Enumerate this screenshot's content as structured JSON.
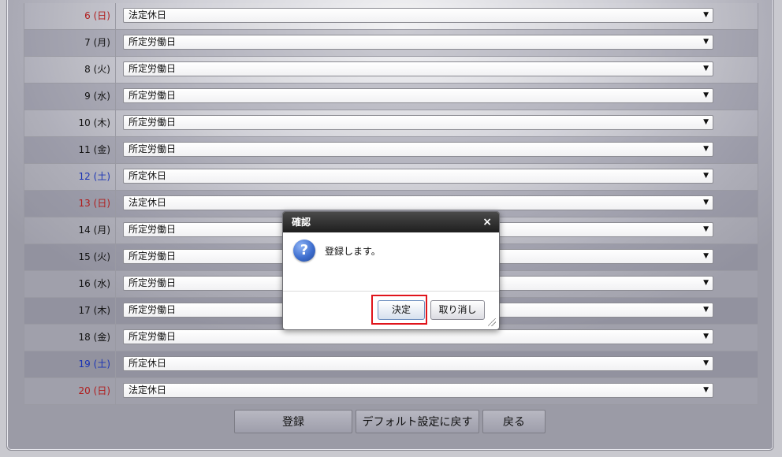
{
  "rows": [
    {
      "day": "6 (日)",
      "type": "sun",
      "value": "法定休日"
    },
    {
      "day": "7 (月)",
      "type": "week",
      "value": "所定労働日"
    },
    {
      "day": "8 (火)",
      "type": "week",
      "value": "所定労働日"
    },
    {
      "day": "9 (水)",
      "type": "week",
      "value": "所定労働日"
    },
    {
      "day": "10 (木)",
      "type": "week",
      "value": "所定労働日"
    },
    {
      "day": "11 (金)",
      "type": "week",
      "value": "所定労働日"
    },
    {
      "day": "12 (土)",
      "type": "sat",
      "value": "所定休日"
    },
    {
      "day": "13 (日)",
      "type": "sun",
      "value": "法定休日"
    },
    {
      "day": "14 (月)",
      "type": "week",
      "value": "所定労働日"
    },
    {
      "day": "15 (火)",
      "type": "week",
      "value": "所定労働日"
    },
    {
      "day": "16 (水)",
      "type": "week",
      "value": "所定労働日"
    },
    {
      "day": "17 (木)",
      "type": "week",
      "value": "所定労働日"
    },
    {
      "day": "18 (金)",
      "type": "week",
      "value": "所定労働日"
    },
    {
      "day": "19 (土)",
      "type": "sat",
      "value": "所定休日"
    },
    {
      "day": "20 (日)",
      "type": "sun",
      "value": "法定休日"
    }
  ],
  "icons": {
    "dropdown": "triangle-down-icon",
    "close": "close-icon",
    "question": "question-icon",
    "resize": "resize-grip-icon"
  },
  "colors": {
    "sunday": "#b01c1c",
    "saturday": "#1b34b5",
    "highlight": "#e0141b"
  },
  "buttons": {
    "register": "登録",
    "default": "デフォルト設定に戻す",
    "back": "戻る"
  },
  "dialog": {
    "title": "確認",
    "close": "×",
    "icon_glyph": "?",
    "message": "登録します。",
    "ok": "決定",
    "cancel": "取り消し"
  }
}
